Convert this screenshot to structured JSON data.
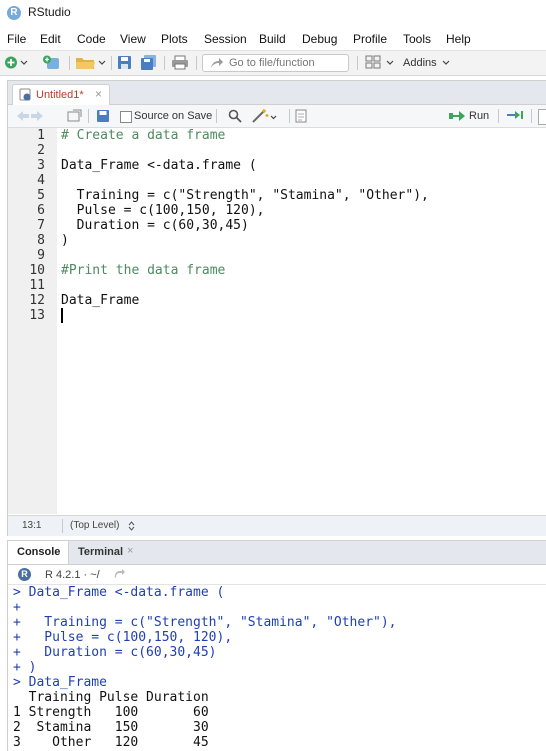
{
  "window": {
    "title": "RStudio",
    "logo_letter": "R"
  },
  "menu": [
    "File",
    "Edit",
    "Code",
    "View",
    "Plots",
    "Session",
    "Build",
    "Debug",
    "Profile",
    "Tools",
    "Help"
  ],
  "toolbar": {
    "goto_placeholder": "Go to file/function",
    "addins_label": "Addins"
  },
  "source": {
    "tab_label": "Untitled1*",
    "source_on_save_label": "Source on Save",
    "run_label": "Run",
    "lines": [
      {
        "n": "1",
        "text": "# Create a data frame"
      },
      {
        "n": "2",
        "text": ""
      },
      {
        "n": "3",
        "text": "Data_Frame <-data.frame ("
      },
      {
        "n": "4",
        "text": ""
      },
      {
        "n": "5",
        "text": "  Training = c(\"Strength\", \"Stamina\", \"Other\"),"
      },
      {
        "n": "6",
        "text": "  Pulse = c(100,150, 120),"
      },
      {
        "n": "7",
        "text": "  Duration = c(60,30,45)"
      },
      {
        "n": "8",
        "text": ")"
      },
      {
        "n": "9",
        "text": ""
      },
      {
        "n": "10",
        "text": "#Print the data frame"
      },
      {
        "n": "11",
        "text": ""
      },
      {
        "n": "12",
        "text": "Data_Frame"
      },
      {
        "n": "13",
        "text": ""
      }
    ],
    "status_position": "13:1",
    "status_scope": "(Top Level)"
  },
  "console": {
    "tabs": [
      "Console",
      "Terminal"
    ],
    "r_version": "R 4.2.1 · ~/",
    "lines": [
      {
        "kind": "input",
        "text": "> Data_Frame <-data.frame ("
      },
      {
        "kind": "input",
        "text": "+"
      },
      {
        "kind": "input",
        "text": "+   Training = c(\"Strength\", \"Stamina\", \"Other\"),"
      },
      {
        "kind": "input",
        "text": "+   Pulse = c(100,150, 120),"
      },
      {
        "kind": "input",
        "text": "+   Duration = c(60,30,45)"
      },
      {
        "kind": "input",
        "text": "+ )"
      },
      {
        "kind": "input",
        "text": "> Data_Frame"
      },
      {
        "kind": "output",
        "text": "  Training Pulse Duration"
      },
      {
        "kind": "output",
        "text": "1 Strength   100       60"
      },
      {
        "kind": "output",
        "text": "2  Stamina   150       30"
      },
      {
        "kind": "output",
        "text": "3    Other   120       45"
      }
    ]
  },
  "colors": {
    "accent": "#75aadb",
    "console_input": "#1f3fb4",
    "comment": "#4d8a5e",
    "string": "#2a6e3f",
    "number": "#2f5bbf",
    "modified_tab": "#c0392b"
  },
  "icons": [
    "new-file-icon",
    "new-project-icon",
    "open-folder-icon",
    "save-icon",
    "save-all-icon",
    "print-icon",
    "goto-arrow-icon",
    "grid-icon",
    "back-arrow-icon",
    "forward-arrow-icon",
    "show-in-window-icon",
    "search-icon",
    "magic-wand-icon",
    "compile-report-icon",
    "run-arrow-icon",
    "rerun-icon",
    "close-icon",
    "r-logo-icon",
    "refresh-icon"
  ]
}
